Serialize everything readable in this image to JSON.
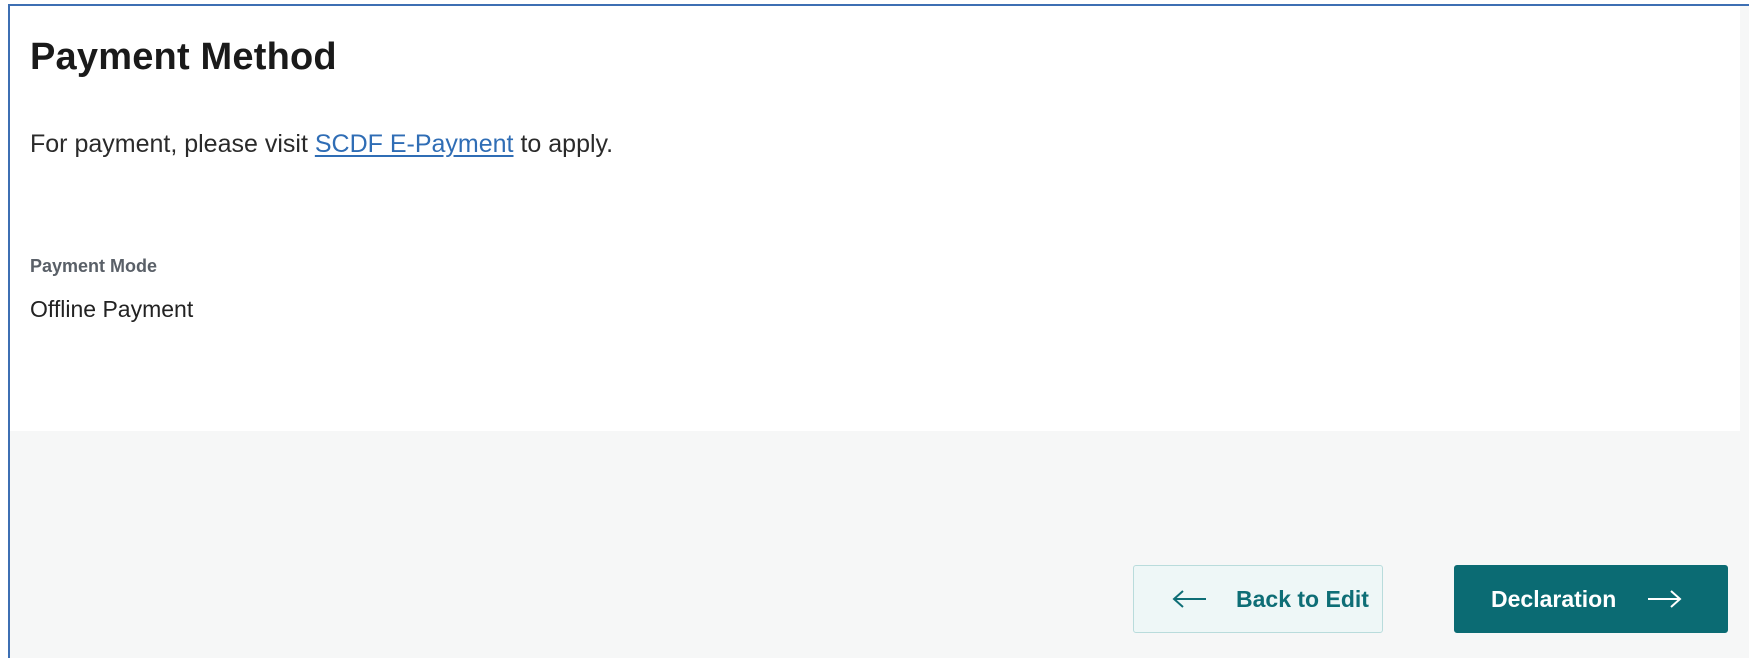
{
  "section": {
    "title": "Payment Method",
    "intro_prefix": "For payment, please visit ",
    "intro_link": "SCDF E-Payment",
    "intro_suffix": " to apply."
  },
  "payment": {
    "mode_label": "Payment Mode",
    "mode_value": "Offline Payment"
  },
  "actions": {
    "back_label": "Back to Edit",
    "next_label": "Declaration",
    "back_icon": "arrow-left-icon",
    "next_icon": "arrow-right-icon"
  },
  "colors": {
    "accent": "#0b6b73",
    "link": "#2f6db5",
    "frame_border": "#3d6fb3"
  }
}
